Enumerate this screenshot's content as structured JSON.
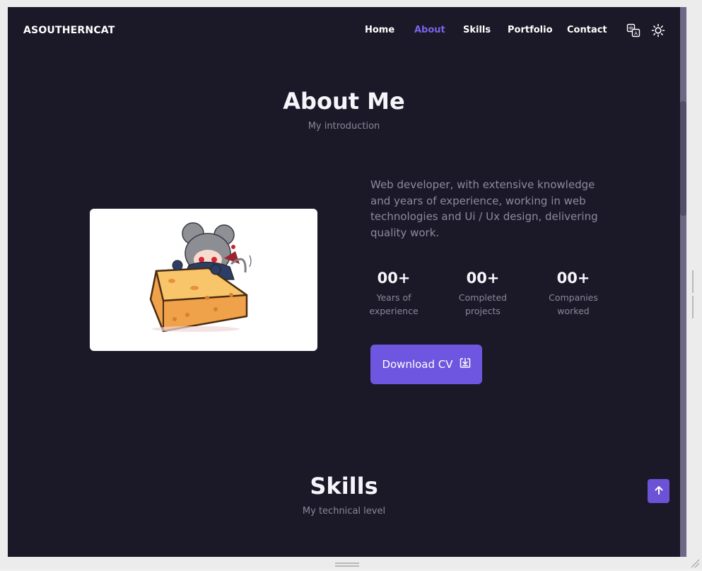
{
  "header": {
    "logo": "ASOUTHERNCAT",
    "nav": [
      {
        "label": "Home",
        "active": false
      },
      {
        "label": "About",
        "active": true
      },
      {
        "label": "Skills",
        "active": false
      },
      {
        "label": "Portfolio",
        "active": false
      },
      {
        "label": "Contact",
        "active": false
      }
    ],
    "icons": [
      "translate-icon",
      "sun-icon"
    ]
  },
  "about": {
    "title": "About Me",
    "subtitle": "My introduction",
    "image": "mouse-girl-cheese-illustration",
    "description": "Web developer, with extensive knowledge and years of experience, working in web technologies and Ui / Ux design, delivering quality work.",
    "stats": [
      {
        "value": "00+",
        "label_line1": "Years of",
        "label_line2": "experience"
      },
      {
        "value": "00+",
        "label_line1": "Completed",
        "label_line2": "projects"
      },
      {
        "value": "00+",
        "label_line1": "Companies",
        "label_line2": "worked"
      }
    ],
    "cv_button": {
      "label": "Download CV",
      "icon": "download-icon"
    }
  },
  "skills": {
    "title": "Skills",
    "subtitle": "My technical level"
  },
  "scroll_top": {
    "icon": "arrow-up-icon"
  },
  "colors": {
    "background": "#1b1827",
    "accent": "#6e56e0",
    "active_nav": "#7a63e9",
    "muted_text": "#8a879a",
    "heading": "#f5f5fa"
  }
}
